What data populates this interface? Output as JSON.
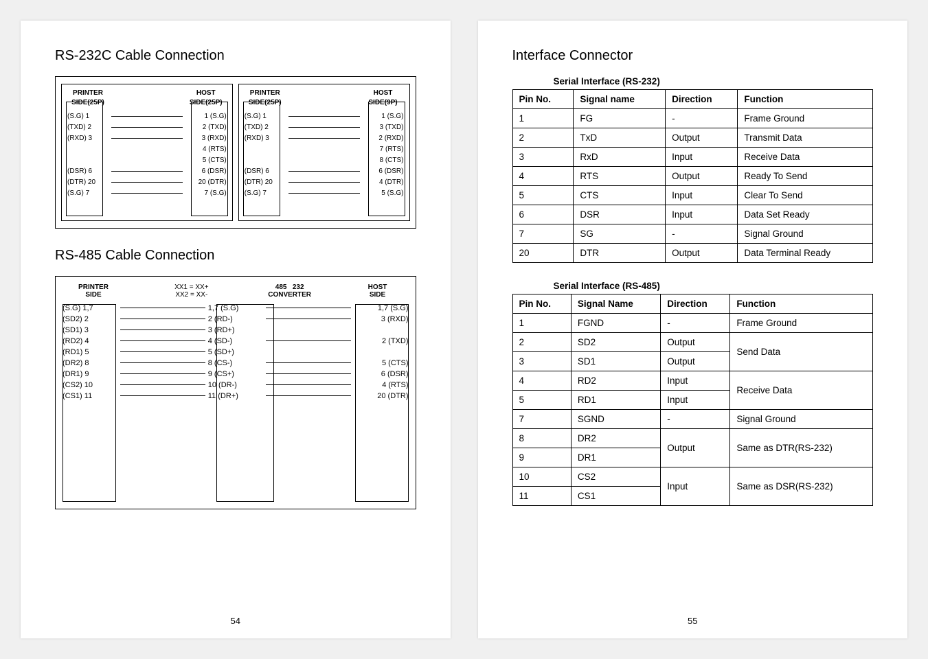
{
  "left": {
    "h1": "RS-232C Cable Connection",
    "h2": "RS-485 Cable Connection",
    "d1a": {
      "head_l": "PRINTER\nSIDE(25P)",
      "head_r": "HOST\nSIDE(25P)",
      "rows": [
        {
          "l": "(S.G)  1",
          "r": "1  (S.G)"
        },
        {
          "l": "(TXD)  2",
          "r": "2  (TXD)"
        },
        {
          "l": "(RXD)  3",
          "r": "3  (RXD)"
        },
        {
          "l": "",
          "r": "4  (RTS)"
        },
        {
          "l": "",
          "r": "5  (CTS)"
        },
        {
          "l": "(DSR)  6",
          "r": "6  (DSR)"
        },
        {
          "l": "(DTR)  20",
          "r": "20 (DTR)"
        },
        {
          "l": "(S.G)  7",
          "r": "7  (S.G)"
        }
      ]
    },
    "d1b": {
      "head_l": "PRINTER\nSIDE(25P)",
      "head_r": "HOST\nSIDE(9P)",
      "rows": [
        {
          "l": "(S.G)  1",
          "r": "1  (S.G)"
        },
        {
          "l": "(TXD)  2",
          "r": "3  (TXD)"
        },
        {
          "l": "(RXD)  3",
          "r": "2  (RXD)"
        },
        {
          "l": "",
          "r": "7  (RTS)"
        },
        {
          "l": "",
          "r": "8  (CTS)"
        },
        {
          "l": "(DSR)  6",
          "r": "6  (DSR)"
        },
        {
          "l": "(DTR)  20",
          "r": "4  (DTR)"
        },
        {
          "l": "(S.G)  7",
          "r": "5  (S.G)"
        }
      ]
    },
    "d2": {
      "head_l": "PRINTER\nSIDE",
      "head_m1": "XX1 = XX+",
      "head_m2": "XX2 = XX-",
      "head_conv": "485   232\nCONVERTER",
      "head_r": "HOST\nSIDE",
      "rows": [
        {
          "l": "(S.G)   1,7",
          "m": "1,7 (S.G)",
          "r": "1,7   (S.G)"
        },
        {
          "l": "(SD2)   2",
          "m": "2  (RD-)",
          "r": "3  (RXD)"
        },
        {
          "l": "(SD1)   3",
          "m": "3  (RD+)",
          "r": ""
        },
        {
          "l": "(RD2)   4",
          "m": "4  (SD-)",
          "r": "2  (TXD)"
        },
        {
          "l": "(RD1)   5",
          "m": "5  (SD+)",
          "r": ""
        },
        {
          "l": "(DR2)   8",
          "m": "8  (CS-)",
          "r": "5  (CTS)"
        },
        {
          "l": "(DR1)   9",
          "m": "9  (CS+)",
          "r": "6  (DSR)"
        },
        {
          "l": "(CS2)  10",
          "m": "10 (DR-)",
          "r": "4  (RTS)"
        },
        {
          "l": "(CS1)  11",
          "m": "11 (DR+)",
          "r": "20 (DTR)"
        }
      ]
    },
    "pagenum": "54"
  },
  "right": {
    "h1": "Interface Connector",
    "t1_caption": "Serial Interface (RS-232)",
    "t1_headers": [
      "Pin No.",
      "Signal name",
      "Direction",
      "Function"
    ],
    "t1_rows": [
      [
        "1",
        "FG",
        "-",
        "Frame Ground"
      ],
      [
        "2",
        "TxD",
        "Output",
        "Transmit Data"
      ],
      [
        "3",
        "RxD",
        "Input",
        "Receive Data"
      ],
      [
        "4",
        "RTS",
        "Output",
        "Ready To Send"
      ],
      [
        "5",
        "CTS",
        "Input",
        "Clear To Send"
      ],
      [
        "6",
        "DSR",
        "Input",
        "Data Set Ready"
      ],
      [
        "7",
        "SG",
        "-",
        "Signal Ground"
      ],
      [
        "20",
        "DTR",
        "Output",
        "Data Terminal Ready"
      ]
    ],
    "t2_caption": "Serial Interface (RS-485)",
    "t2_headers": [
      "Pin No.",
      "Signal Name",
      "Direction",
      "Function"
    ],
    "t2_rows_flat": [
      {
        "pin": "1",
        "sig": "FGND",
        "dir": "-",
        "fn": "Frame Ground"
      },
      {
        "pin": "2",
        "sig": "SD2",
        "dir": "Output",
        "fn_merge_key": "send"
      },
      {
        "pin": "3",
        "sig": "SD1",
        "dir": "Output",
        "fn_merge_key": "send"
      },
      {
        "pin": "4",
        "sig": "RD2",
        "dir": "Input",
        "fn_merge_key": "recv"
      },
      {
        "pin": "5",
        "sig": "RD1",
        "dir": "Input",
        "fn_merge_key": "recv"
      },
      {
        "pin": "7",
        "sig": "SGND",
        "dir": "-",
        "fn": "Signal Ground"
      },
      {
        "pin": "8",
        "sig": "DR2",
        "dir_merge_key": "out89",
        "fn_merge_key": "dtr"
      },
      {
        "pin": "9",
        "sig": "DR1",
        "dir_merge_key": "out89",
        "fn_merge_key": "dtr"
      },
      {
        "pin": "10",
        "sig": "CS2",
        "dir_merge_key": "in1011",
        "fn_merge_key": "dsr"
      },
      {
        "pin": "11",
        "sig": "CS1",
        "dir_merge_key": "in1011",
        "fn_merge_key": "dsr"
      }
    ],
    "t2_fn_merge": {
      "send": "Send Data",
      "recv": "Receive Data",
      "dtr": "Same as DTR(RS-232)",
      "dsr": "Same as DSR(RS-232)"
    },
    "t2_dir_merge": {
      "out89": "Output",
      "in1011": "Input"
    },
    "pagenum": "55"
  }
}
